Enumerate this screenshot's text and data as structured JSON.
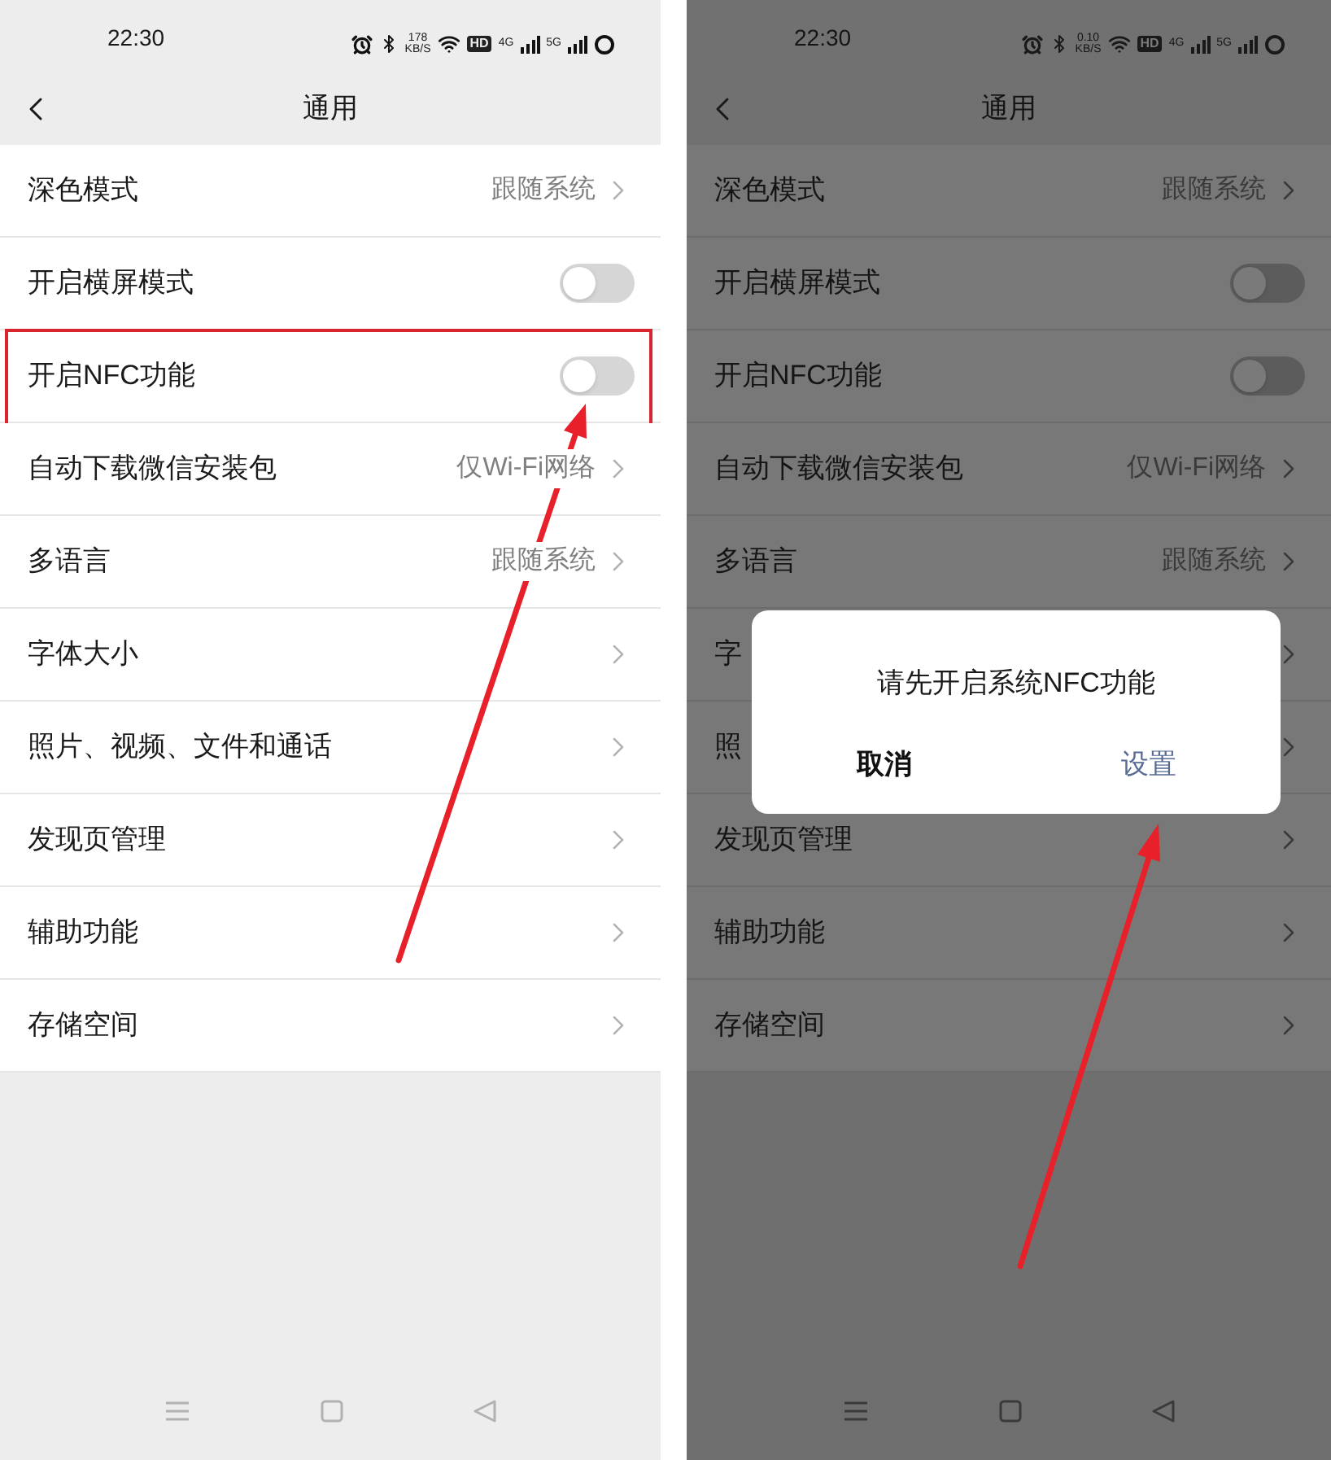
{
  "panels": [
    {
      "dimmed": false,
      "status_bar": {
        "time": "22:30",
        "speed": "178",
        "speed_unit": "KB/S",
        "hd": "HD",
        "net1": "4G",
        "net2": "5G"
      },
      "title": "通用",
      "rows": [
        {
          "kind": "value",
          "label": "深色模式",
          "value": "跟随系统"
        },
        {
          "kind": "toggle",
          "label": "开启横屏模式",
          "on": false
        },
        {
          "kind": "toggle",
          "label": "开启NFC功能",
          "on": false,
          "highlighted": true
        },
        {
          "kind": "value",
          "label": "自动下载微信安装包",
          "value": "仅Wi-Fi网络"
        },
        {
          "kind": "value",
          "label": "多语言",
          "value": "跟随系统"
        },
        {
          "kind": "link",
          "label": "字体大小"
        },
        {
          "kind": "link",
          "label": "照片、视频、文件和通话"
        },
        {
          "kind": "link",
          "label": "发现页管理"
        },
        {
          "kind": "link",
          "label": "辅助功能"
        },
        {
          "kind": "link",
          "label": "存储空间"
        }
      ]
    },
    {
      "dimmed": true,
      "status_bar": {
        "time": "22:30",
        "speed": "0.10",
        "speed_unit": "KB/S",
        "hd": "HD",
        "net1": "4G",
        "net2": "5G"
      },
      "title": "通用",
      "rows": [
        {
          "kind": "value",
          "label": "深色模式",
          "value": "跟随系统"
        },
        {
          "kind": "toggle",
          "label": "开启横屏模式",
          "on": false
        },
        {
          "kind": "toggle",
          "label": "开启NFC功能",
          "on": false,
          "highlighted": false
        },
        {
          "kind": "value",
          "label": "自动下载微信安装包",
          "value": "仅Wi-Fi网络"
        },
        {
          "kind": "value",
          "label": "多语言",
          "value": "跟随系统"
        },
        {
          "kind": "link",
          "label": "字"
        },
        {
          "kind": "link",
          "label": "照"
        },
        {
          "kind": "link",
          "label": "发现页管理"
        },
        {
          "kind": "link",
          "label": "辅助功能"
        },
        {
          "kind": "link",
          "label": "存储空间"
        }
      ],
      "dialog": {
        "message": "请先开启系统NFC功能",
        "buttons": [
          {
            "kind": "cancel",
            "label": "取消"
          },
          {
            "kind": "confirm",
            "label": "设置"
          }
        ]
      }
    }
  ]
}
